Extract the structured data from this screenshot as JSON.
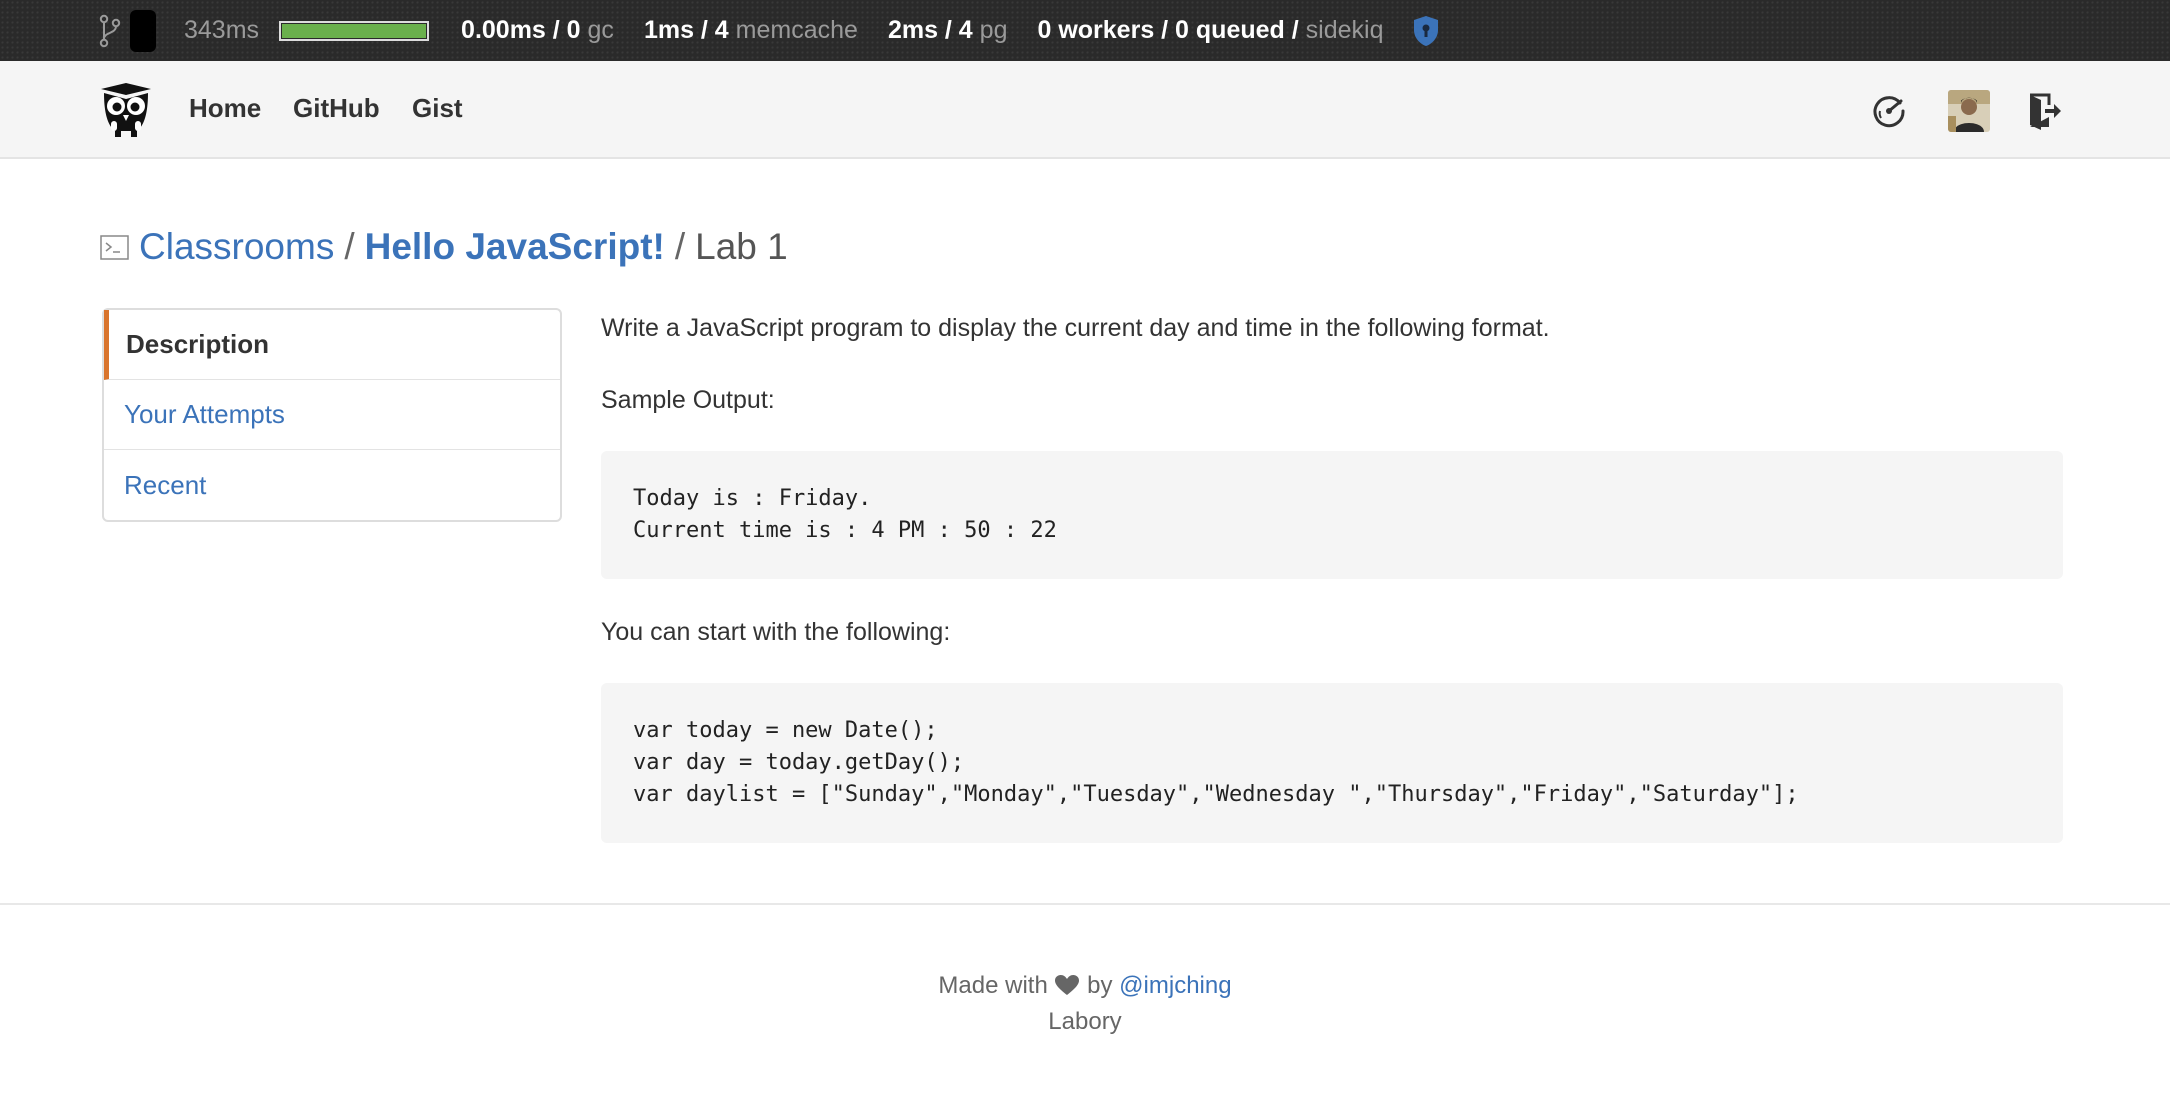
{
  "perf": {
    "total_time": "343ms",
    "progress": 1.0,
    "gc_value": "0.00ms / 0",
    "gc_label": "gc",
    "memcache_value": "1ms / 4",
    "memcache_label": "memcache",
    "pg_value": "2ms / 4",
    "pg_label": "pg",
    "sidekiq_value": "0 workers / 0 queued /",
    "sidekiq_label": "sidekiq",
    "icons": [
      "branch-icon",
      "shield-icon"
    ]
  },
  "nav": {
    "home": "Home",
    "github": "GitHub",
    "gist": "Gist",
    "icons": [
      "owl-logo",
      "dashboard-icon",
      "avatar",
      "sign-out-icon"
    ]
  },
  "breadcrumb": {
    "classrooms": "Classrooms",
    "classroom": "Hello JavaScript!",
    "current": "Lab 1",
    "separator": "/"
  },
  "sidebar": {
    "items": [
      {
        "label": "Description"
      },
      {
        "label": "Your Attempts"
      },
      {
        "label": "Recent"
      }
    ]
  },
  "content": {
    "intro": "Write a JavaScript program to display the current day and time in the following format.",
    "sample_heading": "Sample Output:",
    "sample_code": "Today is : Friday.\nCurrent time is : 4 PM : 50 : 22",
    "start_heading": "You can start with the following:",
    "start_code": "var today = new Date();\nvar day = today.getDay();\nvar daylist = [\"Sunday\",\"Monday\",\"Tuesday\",\"Wednesday \",\"Thursday\",\"Friday\",\"Saturday\"];"
  },
  "footer": {
    "made_with": "Made with",
    "by": "by",
    "author": "@imjching",
    "site": "Labory"
  },
  "colors": {
    "link": "#3b73b9",
    "accent": "#d9742c",
    "progress": "#6ab04c",
    "shield": "#3b73b9"
  }
}
